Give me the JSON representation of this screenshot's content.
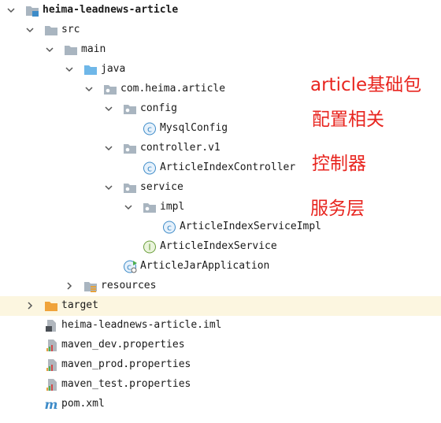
{
  "tree": {
    "root": "heima-leadnews-article",
    "src": "src",
    "main": "main",
    "java": "java",
    "package": "com.heima.article",
    "config": "config",
    "mysql_config": "MysqlConfig",
    "controller_pkg": "controller.v1",
    "controller_class": "ArticleIndexController",
    "service_pkg": "service",
    "impl_pkg": "impl",
    "service_impl": "ArticleIndexServiceImpl",
    "service_iface": "ArticleIndexService",
    "app_class": "ArticleJarApplication",
    "resources": "resources",
    "target": "target",
    "iml": "heima-leadnews-article.iml",
    "prop_dev": "maven_dev.properties",
    "prop_prod": "maven_prod.properties",
    "prop_test": "maven_test.properties",
    "pom": "pom.xml"
  },
  "annotations": {
    "base_package": "article基础包",
    "config": "配置相关",
    "controller": "控制器",
    "service": "服务层"
  },
  "colors": {
    "annotation": "#e8251f",
    "selected_row": "#fcf6e0",
    "folder": "#a9b5c0",
    "source_folder": "#6fb7e8",
    "excluded_folder": "#f0a33a",
    "class_badge": "#3d8bc8",
    "interface_badge": "#6a9e3a"
  },
  "icons": {
    "folder": "folder-icon",
    "package": "package-icon",
    "class": "class-icon",
    "interface": "interface-icon",
    "properties": "properties-file-icon",
    "maven": "maven-icon"
  }
}
